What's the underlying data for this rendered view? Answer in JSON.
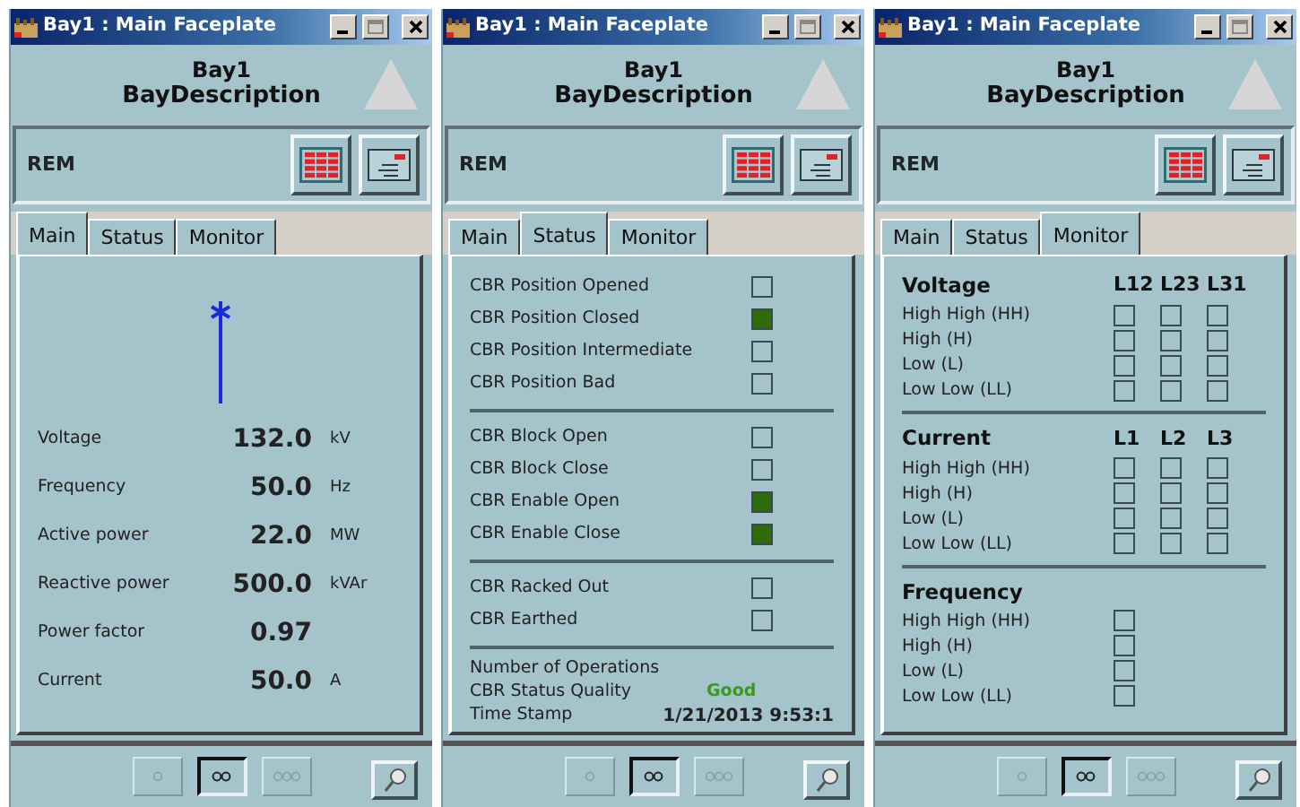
{
  "windows": [
    {
      "title": "Bay1 : Main Faceplate",
      "bay": "Bay1",
      "description": "BayDescription",
      "mode": "REM",
      "kind": "main",
      "tabs": [
        {
          "label": "Main",
          "selected": true
        },
        {
          "label": "Status",
          "selected": false
        },
        {
          "label": "Monitor",
          "selected": false
        }
      ],
      "measurements": [
        {
          "label": "Voltage",
          "value": "132.0",
          "unit": "kV"
        },
        {
          "label": "Frequency",
          "value": "50.0",
          "unit": "Hz"
        },
        {
          "label": "Active power",
          "value": "22.0",
          "unit": "MW"
        },
        {
          "label": "Reactive power",
          "value": "500.0",
          "unit": "kVAr"
        },
        {
          "label": "Power factor",
          "value": "0.97"
        },
        {
          "label": "Current",
          "value": "50.0",
          "unit": "A"
        }
      ],
      "pager": [
        {
          "selected": false
        },
        {
          "selected": true
        },
        {
          "selected": false
        }
      ]
    },
    {
      "title": "Bay1 : Main Faceplate",
      "bay": "Bay1",
      "description": "BayDescription",
      "mode": "REM",
      "kind": "status",
      "tabs": [
        {
          "label": "Main",
          "selected": false
        },
        {
          "label": "Status",
          "selected": true
        },
        {
          "label": "Monitor",
          "selected": false
        }
      ],
      "groups": [
        [
          {
            "label": "CBR Position Opened",
            "on": false
          },
          {
            "label": "CBR Position Closed",
            "on": true
          },
          {
            "label": "CBR Position Intermediate",
            "on": false
          },
          {
            "label": "CBR Position Bad",
            "on": false
          }
        ],
        [
          {
            "label": "CBR Block Open",
            "on": false
          },
          {
            "label": "CBR Block Close",
            "on": false
          },
          {
            "label": "CBR Enable Open",
            "on": true
          },
          {
            "label": "CBR Enable Close",
            "on": true
          }
        ],
        [
          {
            "label": "CBR Racked Out",
            "on": false
          },
          {
            "label": "CBR Earthed",
            "on": false
          }
        ]
      ],
      "info": [
        {
          "label": "Number of Operations",
          "kind": "plain"
        },
        {
          "label": "CBR Status Quality",
          "value": "Good",
          "kind": "quality"
        },
        {
          "label": "Time Stamp",
          "value": "1/21/2013 9:53:1",
          "kind": "timestamp"
        }
      ],
      "pager": [
        {
          "selected": false
        },
        {
          "selected": true
        },
        {
          "selected": false
        }
      ]
    },
    {
      "title": "Bay1 : Main Faceplate",
      "bay": "Bay1",
      "description": "BayDescription",
      "mode": "REM",
      "kind": "monitor",
      "tabs": [
        {
          "label": "Main",
          "selected": false
        },
        {
          "label": "Status",
          "selected": false
        },
        {
          "label": "Monitor",
          "selected": true
        }
      ],
      "sections": [
        {
          "title": "Voltage",
          "columns": [
            "L12",
            "L23",
            "L31"
          ],
          "rows": [
            {
              "label": "High High (HH)",
              "alarms": [
                false,
                false,
                false
              ]
            },
            {
              "label": "High (H)",
              "alarms": [
                false,
                false,
                false
              ]
            },
            {
              "label": "Low (L)",
              "alarms": [
                false,
                false,
                false
              ]
            },
            {
              "label": "Low Low (LL)",
              "alarms": [
                false,
                false,
                false
              ]
            }
          ]
        },
        {
          "title": "Current",
          "columns": [
            "L1",
            "L2",
            "L3"
          ],
          "rows": [
            {
              "label": "High High (HH)",
              "alarms": [
                false,
                false,
                false
              ]
            },
            {
              "label": "High (H)",
              "alarms": [
                false,
                false,
                false
              ]
            },
            {
              "label": "Low (L)",
              "alarms": [
                false,
                false,
                false
              ]
            },
            {
              "label": "Low Low (LL)",
              "alarms": [
                false,
                false,
                false
              ]
            }
          ]
        },
        {
          "title": "Frequency",
          "rows": [
            {
              "label": "High High (HH)",
              "alarms": [
                false
              ]
            },
            {
              "label": "High (H)",
              "alarms": [
                false
              ]
            },
            {
              "label": "Low (L)",
              "alarms": [
                false
              ]
            },
            {
              "label": "Low Low (LL)",
              "alarms": [
                false
              ]
            }
          ]
        }
      ],
      "pager": [
        {
          "selected": false
        },
        {
          "selected": true
        },
        {
          "selected": false
        }
      ]
    }
  ]
}
